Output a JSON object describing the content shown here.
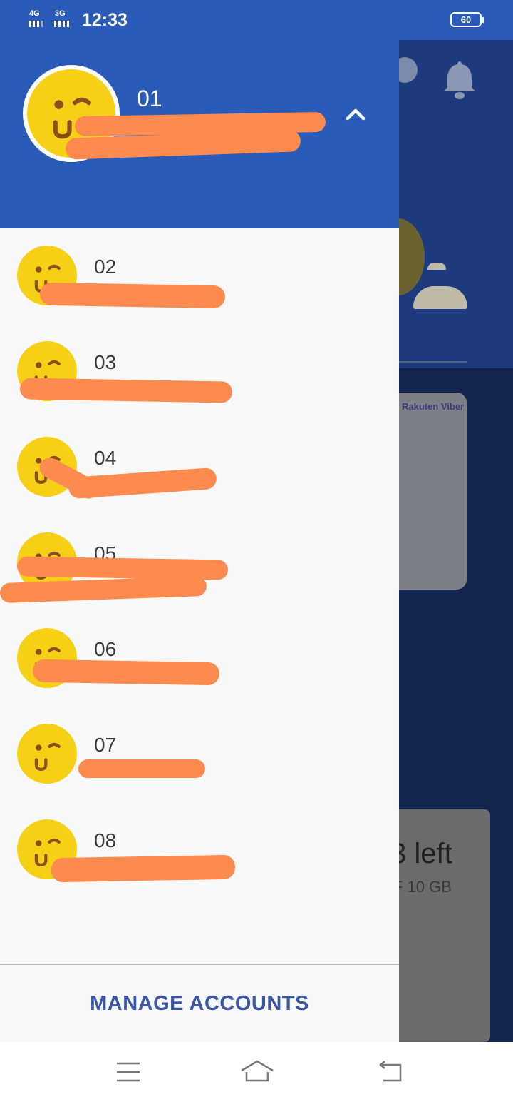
{
  "status": {
    "network1": "4G",
    "network2": "3G",
    "time": "12:33",
    "battery": "60"
  },
  "drawer": {
    "header": {
      "name": "01"
    },
    "accounts": [
      {
        "label": "02"
      },
      {
        "label": "03"
      },
      {
        "label": "04"
      },
      {
        "label": "05"
      },
      {
        "label": "06"
      },
      {
        "label": "07"
      },
      {
        "label": "08"
      }
    ],
    "manage_label": "MANAGE ACCOUNTS"
  },
  "background": {
    "brand": "Rakuten Viber",
    "data_left": "3 left",
    "data_of": "F 10 GB"
  },
  "colors": {
    "header": "#2a5bb8",
    "avatar": "#f5d016",
    "accent": "#3a56a5",
    "redaction": "#fd8a4e"
  },
  "icons": {
    "header_toggle": "chevron-up-icon",
    "notifications": "bell-icon",
    "nav": [
      "menu-icon",
      "home-icon",
      "back-icon"
    ]
  }
}
